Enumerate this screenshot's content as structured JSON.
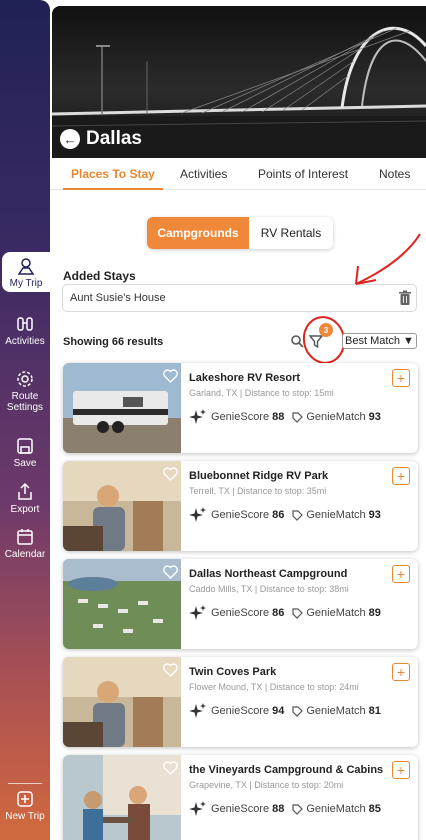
{
  "sidebar": {
    "items": [
      {
        "label": "My Trip",
        "icon": "map-pin-icon"
      },
      {
        "label": "Activities",
        "icon": "binoculars-icon"
      },
      {
        "label": "Route Settings",
        "icon": "gear-icon"
      },
      {
        "label": "Save",
        "icon": "save-icon"
      },
      {
        "label": "Export",
        "icon": "export-icon"
      },
      {
        "label": "Calendar",
        "icon": "calendar-icon"
      }
    ],
    "new_trip": "New Trip"
  },
  "header": {
    "city": "Dallas"
  },
  "tabs": [
    "Places To Stay",
    "Activities",
    "Points of Interest",
    "Notes"
  ],
  "segment": {
    "active": "Campgrounds",
    "inactive": "RV Rentals"
  },
  "added_stays": {
    "label": "Added Stays",
    "value": "Aunt Susie's House"
  },
  "results": {
    "text": "Showing 66 results",
    "filter_count": "3",
    "sort": "Best Match"
  },
  "listings": [
    {
      "name": "Lakeshore RV Resort",
      "location": "Garland, TX | Distance to stop: 15mi",
      "genie_score": "88",
      "genie_match": "93"
    },
    {
      "name": "Bluebonnet Ridge RV Park",
      "location": "Terrell, TX | Distance to stop: 35mi",
      "genie_score": "86",
      "genie_match": "93"
    },
    {
      "name": "Dallas Northeast Campground",
      "location": "Caddo Mills, TX | Distance to stop: 38mi",
      "genie_score": "86",
      "genie_match": "89"
    },
    {
      "name": "Twin Coves Park",
      "location": "Flower Mound, TX | Distance to stop: 24mi",
      "genie_score": "94",
      "genie_match": "81"
    },
    {
      "name": "the Vineyards Campground & Cabins",
      "location": "Grapevine, TX | Distance to stop: 20mi",
      "genie_score": "88",
      "genie_match": "85"
    }
  ],
  "labels": {
    "genie_score": "GenieScore",
    "genie_match": "GenieMatch"
  },
  "colors": {
    "accent": "#f0883a",
    "annotation": "#e0231f"
  }
}
